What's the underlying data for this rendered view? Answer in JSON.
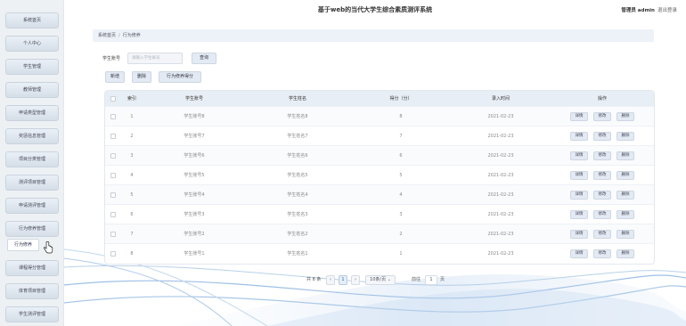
{
  "header": {
    "title": "基于web的当代大学生综合素质测评系统",
    "user_label": "管理员 admin",
    "logout_label": "退出登录"
  },
  "sidebar": {
    "items": [
      {
        "label": "系统首页"
      },
      {
        "label": "个人中心"
      },
      {
        "label": "学生管理"
      },
      {
        "label": "教师管理"
      },
      {
        "label": "申请类型管理"
      },
      {
        "label": "奖惩信息管理"
      },
      {
        "label": "项目分类管理"
      },
      {
        "label": "测评项目管理"
      },
      {
        "label": "申请测评管理"
      },
      {
        "label": "行为修养管理"
      },
      {
        "label": "课程得分管理"
      },
      {
        "label": "体育项目管理"
      },
      {
        "label": "学生测评管理"
      }
    ],
    "sub_item": {
      "label": "行为修养"
    }
  },
  "breadcrumb": {
    "home": "系统首页",
    "separator": "/",
    "current": "行为修养"
  },
  "search": {
    "label": "学生账号",
    "placeholder": "请输入学生账号",
    "button": "查询"
  },
  "actions": {
    "add": "新增",
    "delete": "删除",
    "report": "行为修养得分"
  },
  "table": {
    "columns": [
      "",
      "索引",
      "学生账号",
      "学生姓名",
      "得分（分）",
      "录入时间",
      "操作"
    ],
    "rows": [
      {
        "index": "1",
        "account": "学生账号8",
        "name": "学生姓名8",
        "score": "8",
        "date": "2021-02-23"
      },
      {
        "index": "2",
        "account": "学生账号7",
        "name": "学生姓名7",
        "score": "7",
        "date": "2021-02-23"
      },
      {
        "index": "3",
        "account": "学生账号6",
        "name": "学生姓名6",
        "score": "6",
        "date": "2021-02-23"
      },
      {
        "index": "4",
        "account": "学生账号5",
        "name": "学生姓名5",
        "score": "5",
        "date": "2021-02-23"
      },
      {
        "index": "5",
        "account": "学生账号4",
        "name": "学生姓名4",
        "score": "4",
        "date": "2021-02-23"
      },
      {
        "index": "6",
        "account": "学生账号3",
        "name": "学生姓名3",
        "score": "3",
        "date": "2021-02-23"
      },
      {
        "index": "7",
        "account": "学生账号2",
        "name": "学生姓名2",
        "score": "2",
        "date": "2021-02-23"
      },
      {
        "index": "8",
        "account": "学生账号1",
        "name": "学生姓名1",
        "score": "1",
        "date": "2021-02-23"
      }
    ],
    "row_ops": {
      "detail": "详情",
      "edit": "修改",
      "delete": "删除"
    }
  },
  "pagination": {
    "total": "共 8 条",
    "prev": "‹",
    "page": "1",
    "next": "›",
    "page_size": "10条/页",
    "goto_label": "前往",
    "goto_value": "1",
    "page_unit": "页"
  },
  "icons": {
    "cursor": "hand-pointer-icon"
  },
  "colors": {
    "accent": "#e3eaf3",
    "header_bg": "#e8eef5",
    "wave": "#9fc0e6"
  }
}
